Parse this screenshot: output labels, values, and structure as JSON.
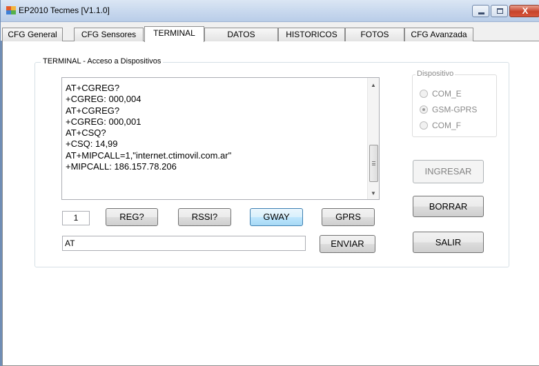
{
  "window": {
    "title": "EP2010 Tecmes  [V1.1.0]",
    "controls": {
      "minimize": "minimize",
      "maximize": "maximize",
      "close": "X"
    }
  },
  "tabs": [
    {
      "label": "CFG General",
      "active": false
    },
    {
      "label": "CFG Sensores",
      "active": false
    },
    {
      "label": "TERMINAL",
      "active": true
    },
    {
      "label": "DATOS",
      "active": false
    },
    {
      "label": "HISTORICOS",
      "active": false
    },
    {
      "label": "FOTOS",
      "active": false
    },
    {
      "label": "CFG Avanzada",
      "active": false
    }
  ],
  "terminal_group": {
    "title": "TERMINAL - Acceso a Dispositivos",
    "lines": [
      "AT+CGREG?",
      "+CGREG: 000,004",
      "AT+CGREG?",
      "+CGREG: 000,001",
      "AT+CSQ?",
      "+CSQ: 14,99",
      "AT+MIPCALL=1,\"internet.ctimovil.com.ar\"",
      "+MIPCALL: 186.157.78.206"
    ],
    "counter_value": "1",
    "buttons": {
      "reg": "REG?",
      "rssi": "RSSI?",
      "gway": "GWAY",
      "gprs": "GPRS",
      "enviar": "ENVIAR"
    },
    "command_input_value": "AT"
  },
  "device_group": {
    "title": "Dispositivo",
    "options": [
      {
        "label": "COM_E",
        "checked": false
      },
      {
        "label": "GSM-GPRS",
        "checked": true
      },
      {
        "label": "COM_F",
        "checked": false
      }
    ]
  },
  "side_buttons": {
    "ingresar": "INGRESAR",
    "borrar": "BORRAR",
    "salir": "SALIR"
  },
  "colors": {
    "titlebar": "#c9d9ee",
    "close_button": "#c7432b",
    "focused_button": "#bee6fd",
    "disabled_text": "#838383"
  }
}
